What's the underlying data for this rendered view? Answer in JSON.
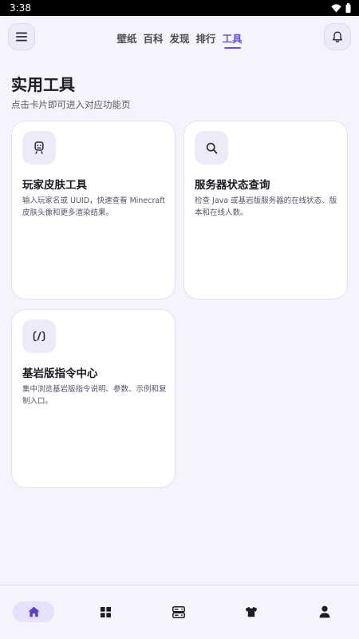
{
  "status_bar": {
    "time": "3:38"
  },
  "header": {
    "tabs": [
      {
        "label": "壁纸",
        "active": false
      },
      {
        "label": "百科",
        "active": false
      },
      {
        "label": "发现",
        "active": false
      },
      {
        "label": "排行",
        "active": false
      },
      {
        "label": "工具",
        "active": true
      }
    ]
  },
  "page": {
    "title": "实用工具",
    "subtitle": "点击卡片即可进入对应功能页"
  },
  "cards": [
    {
      "title": "玩家皮肤工具",
      "desc": "输入玩家名或 UUID，快速查看 Minecraft 皮肤头像和更多渲染结果。",
      "icon": "person-badge-icon"
    },
    {
      "title": "服务器状态查询",
      "desc": "检查 Java 或基岩版服务器的在线状态、版本和在线人数。",
      "icon": "search-icon"
    },
    {
      "title": "基岩版指令中心",
      "desc": "集中浏览基岩版指令说明、参数、示例和复制入口。",
      "icon": "command-icon"
    }
  ],
  "bottom_nav": [
    {
      "icon": "home-icon",
      "active": true
    },
    {
      "icon": "grid-icon",
      "active": false
    },
    {
      "icon": "server-icon",
      "active": false
    },
    {
      "icon": "shirt-icon",
      "active": false
    },
    {
      "icon": "profile-icon",
      "active": false
    }
  ],
  "colors": {
    "accent": "#6c4fd8",
    "background": "#f4f5fc",
    "card": "#ffffff",
    "icon_bg": "#eeeaf8"
  }
}
